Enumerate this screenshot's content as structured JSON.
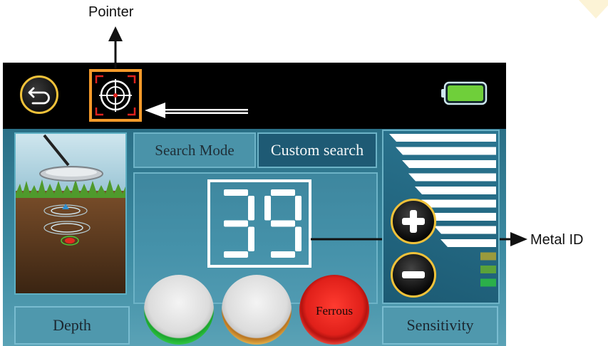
{
  "annotations": {
    "pointer_label": "Pointer",
    "metal_id_label": "Metal ID"
  },
  "top_bar": {
    "back_icon": "back-arrow-icon",
    "pointer_icon": "crosshair-target-icon",
    "battery_icon": "battery-full-icon",
    "battery_level": 1.0,
    "accent_color": "#f59a2a"
  },
  "search": {
    "mode_label": "Search Mode",
    "mode_value": "Custom search"
  },
  "metal_id": {
    "value": "39"
  },
  "discrimination_buttons": [
    {
      "name": "green",
      "label": "",
      "color": "#1aa52c"
    },
    {
      "name": "gold",
      "label": "",
      "color": "#d9992e"
    },
    {
      "name": "ferrous",
      "label": "Ferrous",
      "color": "#e0201a"
    }
  ],
  "depth": {
    "label": "Depth"
  },
  "sensitivity": {
    "label": "Sensitivity",
    "plus_icon": "plus-icon",
    "minus_icon": "minus-icon",
    "bars_total": 12,
    "bars_white": 9,
    "bars_colored": [
      "#9a9a3c",
      "#5aa23a",
      "#2bb04a"
    ]
  }
}
